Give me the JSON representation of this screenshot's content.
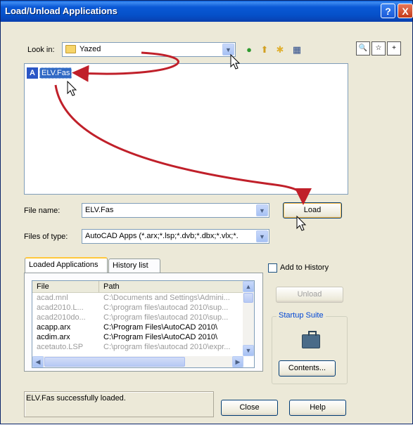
{
  "window": {
    "title": "Load/Unload Applications"
  },
  "title_buttons": {
    "help": "?",
    "close": "X"
  },
  "look_in": {
    "label": "Look in:",
    "value": "Yazed"
  },
  "toolbar": {
    "icons": [
      "back-icon",
      "up-folder-icon",
      "new-folder-icon",
      "views-menu-icon"
    ]
  },
  "right_icons": [
    "find-icon",
    "favorites-icon",
    "add-favorite-icon"
  ],
  "files": [
    {
      "name": "ELV.Fas",
      "selected": true
    }
  ],
  "file_name": {
    "label": "File name:",
    "value": "ELV.Fas"
  },
  "file_type": {
    "label": "Files of type:",
    "value": "AutoCAD Apps (*.arx;*.lsp;*.dvb;*.dbx;*.vlx;*."
  },
  "buttons": {
    "load": "Load",
    "unload": "Unload",
    "contents": "Contents...",
    "close": "Close",
    "help": "Help"
  },
  "tabs": [
    {
      "label": "Loaded Applications",
      "active": true
    },
    {
      "label": "History list",
      "active": false
    }
  ],
  "add_to_history": {
    "label": "Add to History",
    "checked": false
  },
  "loaded_apps": {
    "columns": [
      "File",
      "Path"
    ],
    "rows": [
      {
        "file": "acad.mnl",
        "path": "C:\\Documents and Settings\\Admini...",
        "dim": true
      },
      {
        "file": "acad2010.L...",
        "path": "C:\\program files\\autocad 2010\\sup...",
        "dim": true
      },
      {
        "file": "acad2010do...",
        "path": "C:\\program files\\autocad 2010\\sup...",
        "dim": true
      },
      {
        "file": "acapp.arx",
        "path": "C:\\Program Files\\AutoCAD 2010\\",
        "dim": false
      },
      {
        "file": "acdim.arx",
        "path": "C:\\Program Files\\AutoCAD 2010\\",
        "dim": false
      },
      {
        "file": "acetauto.LSP",
        "path": "C:\\program files\\autocad 2010\\expr...",
        "dim": true
      }
    ]
  },
  "startup_suite": {
    "label": "Startup Suite"
  },
  "status": {
    "text": "ELV.Fas successfully loaded."
  },
  "colors": {
    "title_bar": "#0550c8",
    "selection": "#316ac5",
    "annotation_arrow": "#c0202a"
  }
}
